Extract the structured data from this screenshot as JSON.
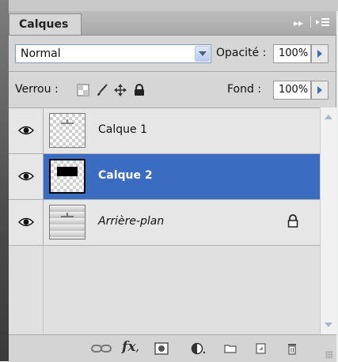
{
  "panel": {
    "tab_title": "Calques",
    "menu_icons": [
      "double-arrow-icon",
      "panel-menu-icon"
    ]
  },
  "blend": {
    "mode": "Normal",
    "opacity_label": "Opacité :",
    "opacity_value": "100%"
  },
  "lock": {
    "label": "Verrou :",
    "icons": [
      "lock-transparency-icon",
      "lock-paint-icon",
      "lock-position-icon",
      "lock-all-icon"
    ],
    "fill_label": "Fond :",
    "fill_value": "100%"
  },
  "layers": [
    {
      "name": "Calque 1",
      "visible": true,
      "selected": false,
      "locked": false
    },
    {
      "name": "Calque 2",
      "visible": true,
      "selected": true,
      "locked": false
    },
    {
      "name": "Arrière-plan",
      "visible": true,
      "selected": false,
      "locked": true
    }
  ],
  "colors": {
    "selection": "#3a6dc1",
    "accent_arrow": "#3a6fb5"
  },
  "footer_icons": [
    "link-layers-icon",
    "fx-icon",
    "add-mask-icon",
    "adjustment-layer-icon",
    "new-group-icon",
    "new-layer-icon",
    "delete-layer-icon"
  ]
}
